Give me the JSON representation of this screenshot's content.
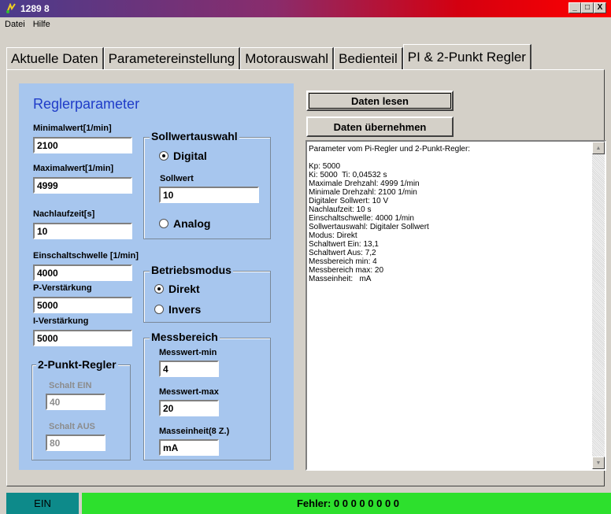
{
  "window": {
    "title": "1289 8",
    "min_glyph": "_",
    "max_glyph": "□",
    "close_glyph": "X"
  },
  "menu": {
    "items": [
      "Datei",
      "Hilfe"
    ]
  },
  "tabs": [
    {
      "label": "Aktuelle Daten"
    },
    {
      "label": "Parametereinstellung"
    },
    {
      "label": "Motorauswahl"
    },
    {
      "label": "Bedienteil"
    },
    {
      "label": "PI & 2-Punkt Regler"
    }
  ],
  "active_tab": "PI & 2-Punkt Regler",
  "regler": {
    "title": "Reglerparameter",
    "minimalwert_label": "Minimalwert[1/min]",
    "minimalwert_value": "2100",
    "maximalwert_label": "Maximalwert[1/min]",
    "maximalwert_value": "4999",
    "nachlaufzeit_label": "Nachlaufzeit[s]",
    "nachlaufzeit_value": "10",
    "einschaltschwelle_label": "Einschaltschwelle [1/min]",
    "einschaltschwelle_value": "4000",
    "p_verstaerkung_label": "P-Verstärkung",
    "p_verstaerkung_value": "5000",
    "i_verstaerkung_label": "I-Verstärkung",
    "i_verstaerkung_value": "5000"
  },
  "sollwertauswahl": {
    "title": "Sollwertauswahl",
    "digital_label": "Digital",
    "analog_label": "Analog",
    "selected": "Digital",
    "sollwert_label": "Sollwert",
    "sollwert_value": "10"
  },
  "betriebsmodus": {
    "title": "Betriebsmodus",
    "direkt_label": "Direkt",
    "invers_label": "Invers",
    "selected": "Direkt"
  },
  "messbereich": {
    "title": "Messbereich",
    "min_label": "Messwert-min",
    "min_value": "4",
    "max_label": "Messwert-max",
    "max_value": "20",
    "einheit_label": "Masseinheit(8 Z.)",
    "einheit_value": "mA"
  },
  "zweipunkt": {
    "title": "2-Punkt-Regler",
    "ein_label": "Schalt EIN",
    "ein_value": "40",
    "aus_label": "Schalt AUS",
    "aus_value": "80"
  },
  "buttons": {
    "daten_lesen": "Daten lesen",
    "daten_uebernehmen": "Daten übernehmen"
  },
  "output_text": "Parameter vom Pi-Regler und 2-Punkt-Regler:\n\nKp: 5000\nKi: 5000  Ti: 0,04532 s\nMaximale Drehzahl: 4999 1/min\nMinimale Drehzahl: 2100 1/min\nDigitaler Sollwert: 10 V\nNachlaufzeit: 10 s\nEinschaltschwelle: 4000 1/min\nSollwertauswahl: Digitaler Sollwert\nModus: Direkt\nSchaltwert Ein: 13,1\nSchaltwert Aus: 7,2\nMessbereich min: 4\nMessbereich max: 20\nMasseinheit:   mA",
  "status": {
    "left": "EIN",
    "right": "Fehler: 0 0 0 0 0 0 0 0"
  },
  "colors": {
    "panel_blue": "#a7c6ee",
    "title_blue": "#1f3cc8",
    "status_teal": "#0d8a8a",
    "status_green": "#2de02d"
  }
}
